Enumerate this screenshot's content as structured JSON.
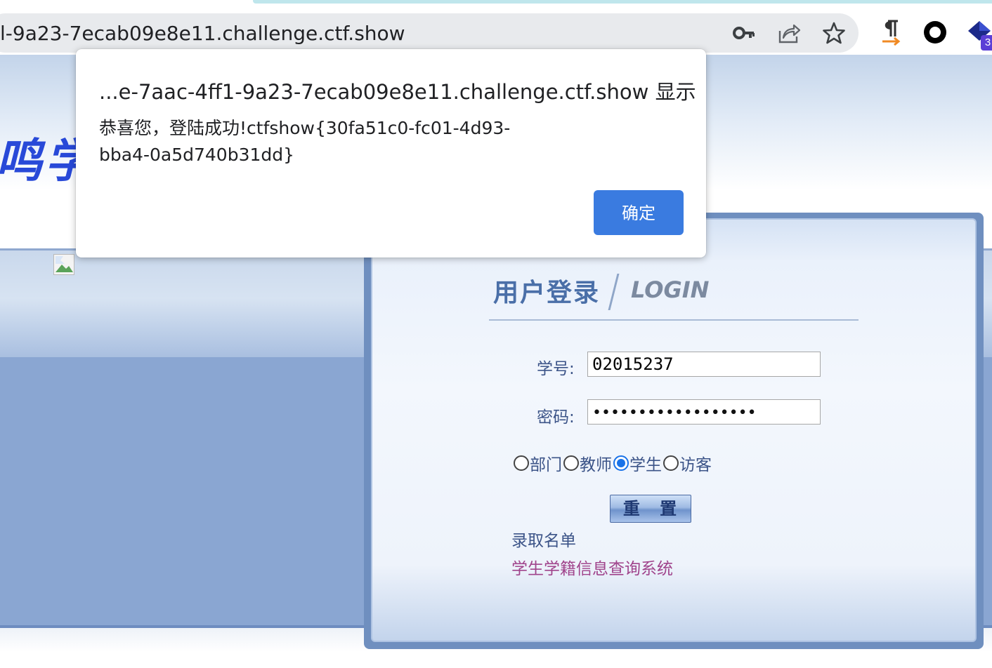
{
  "browser": {
    "url": "l-9a23-7ecab09e8e11.challenge.ctf.show",
    "icons": [
      "key-icon",
      "share-icon",
      "star-icon",
      "pilcrow-extension-icon",
      "circle-extension-icon",
      "diamond-extension-icon"
    ],
    "extension_badge": "3"
  },
  "page": {
    "logo_text": "鸣学"
  },
  "login": {
    "title_cn": "用户登录",
    "title_en": "LOGIN",
    "student_id_label": "学号:",
    "student_id_value": "02015237",
    "password_label": "密码:",
    "password_mask": "••••••••••••••••••",
    "roles": [
      {
        "label": "部门",
        "checked": false
      },
      {
        "label": "教师",
        "checked": false
      },
      {
        "label": "学生",
        "checked": true
      },
      {
        "label": "访客",
        "checked": false
      }
    ],
    "reset_label": "重 置",
    "links": {
      "admission_list": "录取名单",
      "student_info_system": "学生学籍信息查询系统"
    },
    "colors": {
      "link_blue": "#3c5488",
      "link_visited": "#a0448c"
    }
  },
  "dialog": {
    "title": "...e-7aac-4ff1-9a23-7ecab09e8e11.challenge.ctf.show 显示",
    "message": "恭喜您，登陆成功!ctfshow{30fa51c0-fc01-4d93-bba4-0a5d740b31dd}",
    "ok_label": "确定",
    "accent_color": "#3a7be0"
  }
}
